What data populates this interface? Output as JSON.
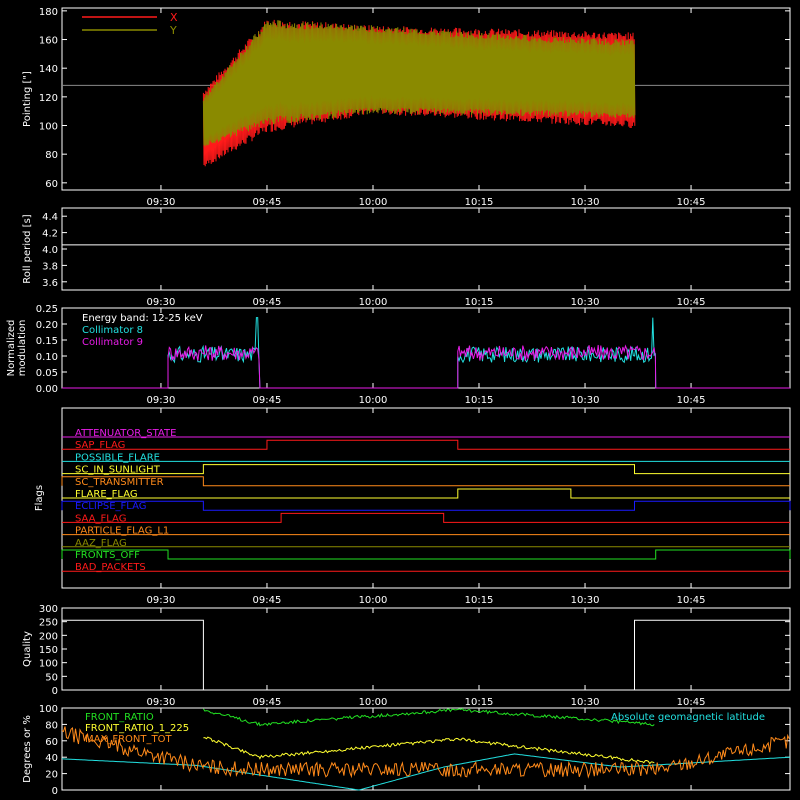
{
  "colors": {
    "background": "#000000",
    "axis": "#ffffff",
    "red": "#ff1a1a",
    "olive": "#8a8a00",
    "cyan": "#22e0e0",
    "magenta": "#e81de8",
    "yellow": "#ffff30",
    "orange": "#ff8a1a",
    "green": "#22e022",
    "blue": "#1a1aff",
    "gray": "#8a8a8a"
  },
  "time_axis": {
    "range": [
      "09:16",
      "10:59"
    ],
    "ticks": [
      "09:30",
      "09:45",
      "10:00",
      "10:15",
      "10:30",
      "10:45"
    ]
  },
  "chart_data": [
    {
      "type": "line",
      "id": "pointing",
      "ylabel": "Pointing [\"]",
      "ylim": [
        55,
        182
      ],
      "yticks": [
        "60",
        "80",
        "100",
        "120",
        "140",
        "160",
        "180"
      ],
      "legend": [
        "X",
        "Y"
      ],
      "legend_placement": "top-left",
      "series": [
        {
          "name": "X",
          "color": "red",
          "x": [
            "09:36",
            "09:45",
            "10:00",
            "10:15",
            "10:30",
            "10:37"
          ],
          "upper": [
            125,
            175,
            170,
            168,
            166,
            165
          ],
          "lower": [
            70,
            95,
            108,
            104,
            100,
            98
          ]
        },
        {
          "name": "Y",
          "color": "olive",
          "x": [
            "09:36",
            "09:45",
            "10:00",
            "10:15",
            "10:30",
            "10:37"
          ],
          "upper": [
            120,
            174,
            170,
            165,
            161,
            160
          ],
          "lower": [
            85,
            100,
            108,
            107,
            106,
            104
          ]
        }
      ],
      "reference_line": {
        "y": 128,
        "color": "gray"
      }
    },
    {
      "type": "line",
      "id": "roll_period",
      "ylabel": "Roll period [s]",
      "ylim": [
        3.5,
        4.5
      ],
      "yticks": [
        "3.6",
        "3.8",
        "4.0",
        "4.2",
        "4.4"
      ],
      "series": [
        {
          "color": "axis",
          "x": [
            "09:16",
            "10:59"
          ],
          "y": [
            4.05,
            4.05
          ]
        }
      ]
    },
    {
      "type": "line",
      "id": "modulation",
      "ylabel": "Normalized modulation",
      "ylim": [
        0,
        0.25
      ],
      "yticks": [
        "0.00",
        "0.05",
        "0.10",
        "0.15",
        "0.20",
        "0.25"
      ],
      "annotation": "Energy band: 12-25 keV",
      "legend": [
        "Collimator 8",
        "Collimator 9"
      ],
      "series": [
        {
          "name": "Collimator 8",
          "color": "cyan",
          "segments": [
            [
              "09:31",
              "09:44"
            ],
            [
              "10:12",
              "10:40"
            ]
          ],
          "level": 0.105,
          "peak": 0.22
        },
        {
          "name": "Collimator 9",
          "color": "magenta",
          "segments": [
            [
              "09:31",
              "09:44"
            ],
            [
              "10:12",
              "10:40"
            ]
          ],
          "level": 0.11
        }
      ]
    },
    {
      "type": "line",
      "id": "flags",
      "ylabel": "Flags",
      "flags": [
        {
          "name": "ATTENUATOR_STATE",
          "color": "magenta",
          "high": []
        },
        {
          "name": "SAP_FLAG",
          "color": "red",
          "high": [
            [
              "09:45",
              "10:12"
            ]
          ]
        },
        {
          "name": "POSSIBLE_FLARE",
          "color": "cyan",
          "high": []
        },
        {
          "name": "SC_IN_SUNLIGHT",
          "color": "yellow",
          "high": [
            [
              "09:36",
              "10:37"
            ]
          ]
        },
        {
          "name": "SC_TRANSMITTER",
          "color": "orange",
          "high": [
            [
              "09:16",
              "09:36"
            ]
          ]
        },
        {
          "name": "FLARE_FLAG",
          "color": "yellow",
          "high": [
            [
              "10:12",
              "10:28"
            ]
          ]
        },
        {
          "name": "ECLIPSE_FLAG",
          "color": "blue",
          "high": [
            [
              "09:16",
              "09:36"
            ],
            [
              "10:37",
              "10:59"
            ]
          ]
        },
        {
          "name": "SAA_FLAG",
          "color": "red",
          "high": [
            [
              "09:47",
              "10:10"
            ]
          ]
        },
        {
          "name": "PARTICLE_FLAG_L1",
          "color": "orange",
          "high": []
        },
        {
          "name": "AAZ_FLAG",
          "color": "olive",
          "high": []
        },
        {
          "name": "FRONTS_OFF",
          "color": "green",
          "high": [
            [
              "09:16",
              "09:31"
            ],
            [
              "10:40",
              "10:59"
            ]
          ]
        },
        {
          "name": "BAD_PACKETS",
          "color": "red",
          "high": []
        }
      ]
    },
    {
      "type": "line",
      "id": "quality",
      "ylabel": "Quality",
      "ylim": [
        0,
        300
      ],
      "yticks": [
        "0",
        "50",
        "100",
        "150",
        "200",
        "250",
        "300"
      ],
      "series": [
        {
          "color": "axis",
          "x": [
            "09:16",
            "09:36",
            "09:36",
            "10:37",
            "10:37",
            "10:59"
          ],
          "y": [
            255,
            255,
            0,
            0,
            255,
            255
          ]
        }
      ]
    },
    {
      "type": "line",
      "id": "degrees",
      "ylabel": "Degrees or %",
      "ylim": [
        0,
        100
      ],
      "yticks": [
        "0",
        "20",
        "40",
        "60",
        "80",
        "100"
      ],
      "legend": [
        "FRONT_RATIO",
        "FRONT_RATIO_1_225",
        "MAX_FRONT_TOT"
      ],
      "annotation": "Absolute geomagnetic latitude",
      "series": [
        {
          "name": "Absolute geomagnetic latitude",
          "color": "cyan",
          "x": [
            "09:16",
            "09:35",
            "09:58",
            "10:10",
            "10:20",
            "10:35",
            "10:59"
          ],
          "y": [
            38,
            30,
            0,
            28,
            44,
            28,
            40
          ]
        },
        {
          "name": "FRONT_RATIO",
          "color": "green",
          "x": [
            "09:36",
            "09:44",
            "10:12",
            "10:40"
          ],
          "y": [
            98,
            80,
            98,
            80
          ]
        },
        {
          "name": "FRONT_RATIO_1_225",
          "color": "yellow",
          "x": [
            "09:36",
            "09:44",
            "10:12",
            "10:40"
          ],
          "y": [
            65,
            40,
            62,
            33
          ]
        },
        {
          "name": "MAX_FRONT_TOT",
          "color": "orange",
          "x": [
            "09:16",
            "09:36",
            "09:44",
            "10:12",
            "10:40",
            "10:59"
          ],
          "y": [
            70,
            28,
            25,
            25,
            25,
            60
          ]
        }
      ]
    }
  ]
}
